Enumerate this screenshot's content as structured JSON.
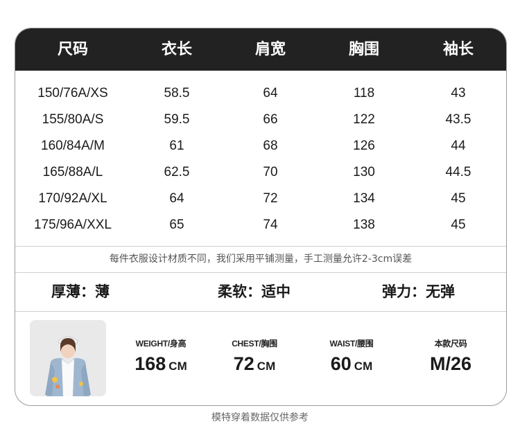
{
  "table": {
    "headers": [
      "尺码",
      "衣长",
      "肩宽",
      "胸围",
      "袖长"
    ],
    "rows": [
      [
        "150/76A/XS",
        "58.5",
        "64",
        "118",
        "43"
      ],
      [
        "155/80A/S",
        "59.5",
        "66",
        "122",
        "43.5"
      ],
      [
        "160/84A/M",
        "61",
        "68",
        "126",
        "44"
      ],
      [
        "165/88A/L",
        "62.5",
        "70",
        "130",
        "44.5"
      ],
      [
        "170/92A/XL",
        "64",
        "72",
        "134",
        "45"
      ],
      [
        "175/96A/XXL",
        "65",
        "74",
        "138",
        "45"
      ]
    ]
  },
  "note": "每件衣服设计材质不同，我们采用平铺测量，手工测量允许2-3cm误差",
  "properties": {
    "thickness": "厚薄：薄",
    "softness": "柔软：适中",
    "elasticity": "弹力：无弹"
  },
  "model": {
    "weight_label": "WEIGHT/身高",
    "weight_value": "168",
    "weight_unit": "CM",
    "chest_label": "CHEST/胸围",
    "chest_value": "72",
    "chest_unit": "CM",
    "waist_label": "WAIST/腰围",
    "waist_value": "60",
    "waist_unit": "CM",
    "size_label": "本款尺码",
    "size_value": "M/26"
  },
  "footer": "模特穿着数据仅供参考",
  "colors": {
    "header_bg": "#222222",
    "header_text": "#ffffff",
    "photo_bg": "#e7e7e7"
  }
}
